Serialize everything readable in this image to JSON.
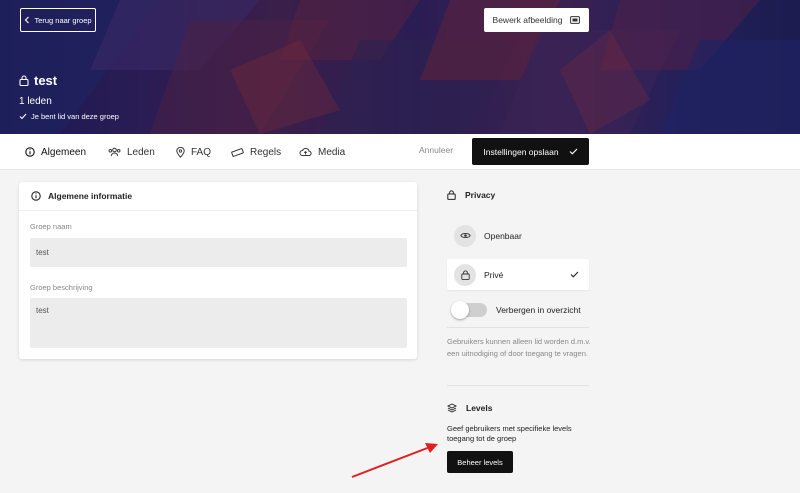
{
  "header": {
    "back_label": "Terug naar groep",
    "edit_image_label": "Bewerk afbeelding",
    "group_name": "test",
    "members": "1 leden",
    "membership_note": "Je bent lid van deze groep"
  },
  "tabs": [
    {
      "label": "Algemeen",
      "icon": "info-icon"
    },
    {
      "label": "Leden",
      "icon": "users-icon"
    },
    {
      "label": "FAQ",
      "icon": "map-pin-icon"
    },
    {
      "label": "Regels",
      "icon": "ruler-icon"
    },
    {
      "label": "Media",
      "icon": "cloud-upload-icon"
    }
  ],
  "actions": {
    "cancel_label": "Annuleer",
    "save_label": "Instellingen opslaan"
  },
  "general_info": {
    "title": "Algemene informatie",
    "name_label": "Groep naam",
    "name_value": "test",
    "description_label": "Groep beschrijving",
    "description_value": "test"
  },
  "privacy": {
    "title": "Privacy",
    "options": [
      {
        "label": "Openbaar",
        "icon": "eye-icon",
        "selected": false
      },
      {
        "label": "Privé",
        "icon": "lock-icon",
        "selected": true
      }
    ],
    "hide_toggle_label": "Verbergen in overzicht",
    "hide_toggle_on": false,
    "note": "Gebruikers kunnen alleen lid worden d.m.v. een uitnodiging of door toegang te vragen."
  },
  "levels": {
    "title": "Levels",
    "description": "Geef gebruikers met specifieke levels toegang tot de groep",
    "button_label": "Beheer levels"
  },
  "colors": {
    "primary_button": "#111111",
    "annotation_arrow": "#e02020"
  }
}
